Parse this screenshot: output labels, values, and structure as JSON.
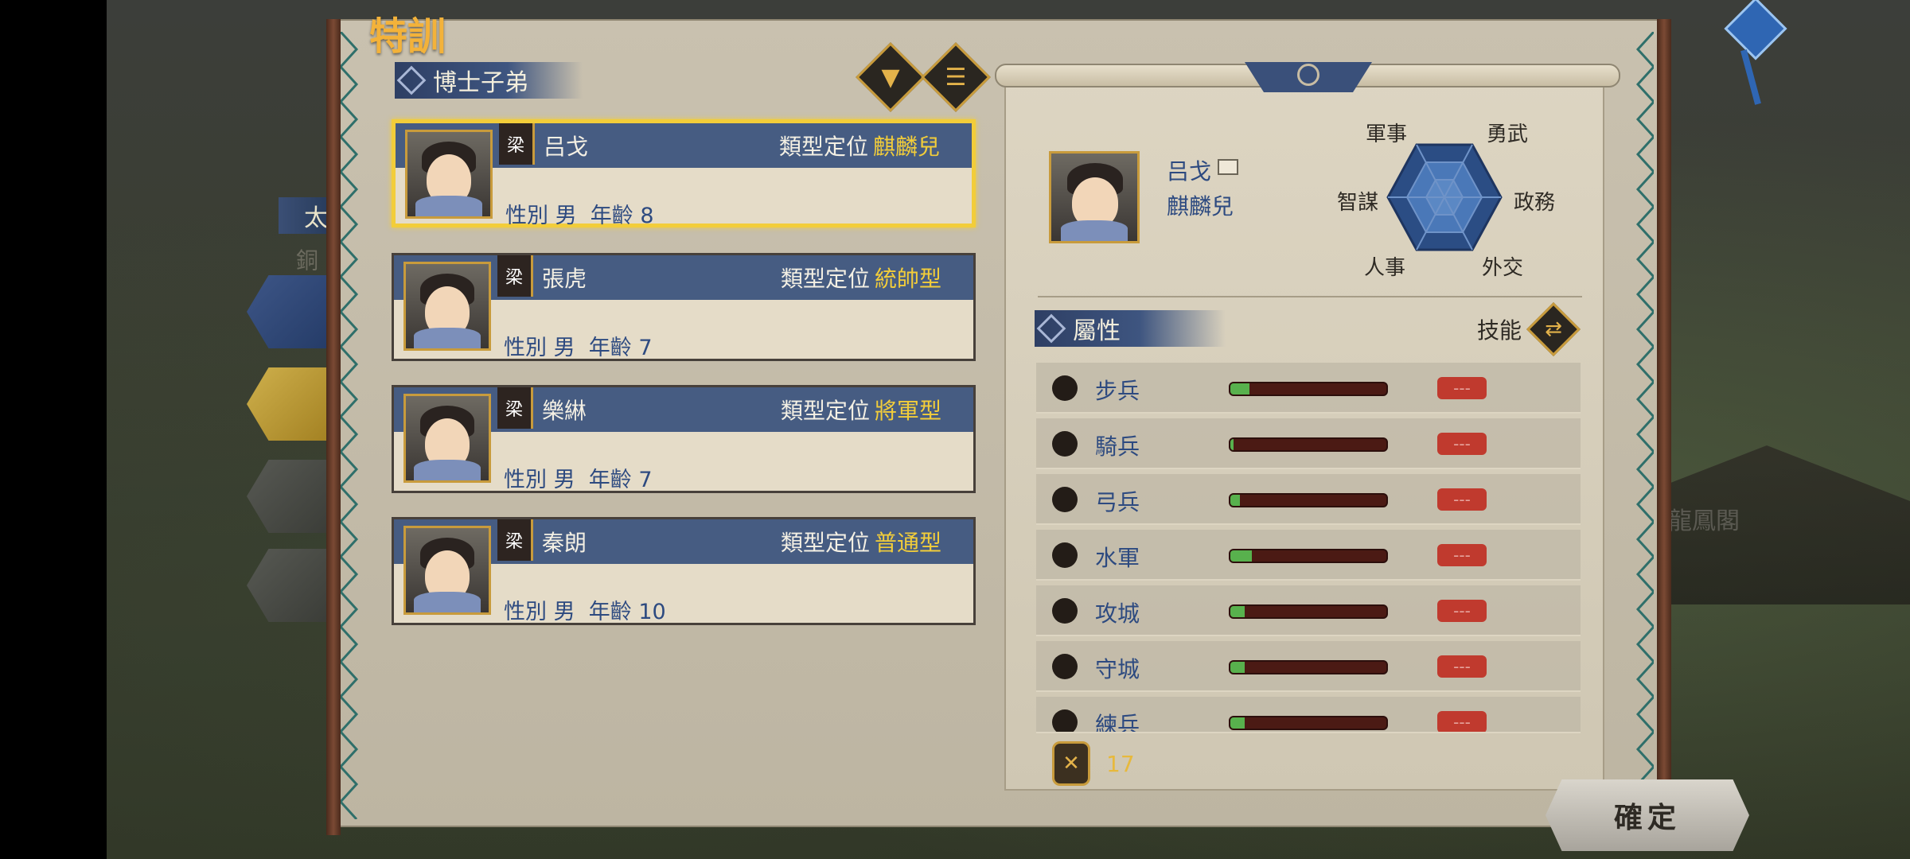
{
  "panel": {
    "title": "特訓"
  },
  "background": {
    "building_label": "龍鳳閣",
    "side_tab": "太",
    "side_sub": "銅"
  },
  "list": {
    "header": "博士子弟",
    "filter_icon": "filter-icon",
    "menu_icon": "list-icon",
    "role_label": "類型定位",
    "gender_label": "性別",
    "age_label": "年齡",
    "students": [
      {
        "clan": "梁",
        "name": "吕戈",
        "role": "麒麟兒",
        "gender": "男",
        "age": "8",
        "selected": true
      },
      {
        "clan": "梁",
        "name": "張虎",
        "role": "統帥型",
        "gender": "男",
        "age": "7",
        "selected": false
      },
      {
        "clan": "梁",
        "name": "樂綝",
        "role": "將軍型",
        "gender": "男",
        "age": "7",
        "selected": false
      },
      {
        "clan": "梁",
        "name": "秦朗",
        "role": "普通型",
        "gender": "男",
        "age": "10",
        "selected": false
      }
    ]
  },
  "detail": {
    "name": "吕戈",
    "role": "麒麟兒",
    "radar_labels": {
      "military": "軍事",
      "valor": "勇武",
      "strategy": "智謀",
      "politics": "政務",
      "personnel": "人事",
      "diplomacy": "外交"
    },
    "attr_header": "屬性",
    "skill_label": "技能",
    "attributes": [
      {
        "label": "步兵",
        "level": 0.12,
        "value": "---"
      },
      {
        "label": "騎兵",
        "level": 0.02,
        "value": "---"
      },
      {
        "label": "弓兵",
        "level": 0.06,
        "value": "---"
      },
      {
        "label": "水軍",
        "level": 0.14,
        "value": "---"
      },
      {
        "label": "攻城",
        "level": 0.09,
        "value": "---"
      },
      {
        "label": "守城",
        "level": 0.09,
        "value": "---"
      },
      {
        "label": "練兵",
        "level": 0.09,
        "value": "---"
      }
    ],
    "resource_value": "17"
  },
  "confirm_label": "確定",
  "colors": {
    "accent_gold": "#f2cd3a",
    "band_blue": "#465c82",
    "text_blue": "#2d4a80",
    "bar_green": "#58b14d"
  }
}
